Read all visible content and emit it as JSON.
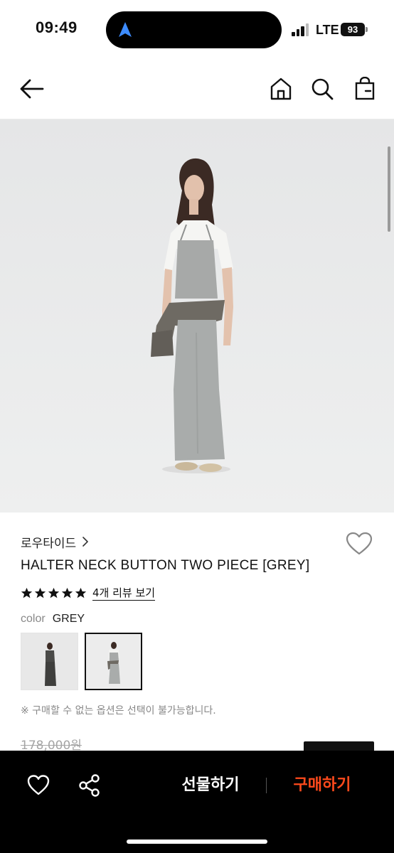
{
  "status_bar": {
    "time": "09:49",
    "network": "LTE",
    "battery": "93"
  },
  "nav": {
    "icons": [
      "back-arrow-icon",
      "home-icon",
      "search-icon",
      "shopping-bag-icon"
    ]
  },
  "product": {
    "brand": "로우타이드",
    "title": "HALTER NECK BUTTON TWO PIECE [GREY]",
    "rating_stars": 5,
    "review_link": "4개 리뷰 보기",
    "color_label": "color",
    "color_value": "GREY",
    "notice": "※ 구매할 수 없는 옵션은 선택이 불가능합니다.",
    "original_price": "178,000원"
  },
  "colors": {
    "background_image": "#e9eaea",
    "buy_accent": "#ff4a1c",
    "bottom_bar": "#000000"
  },
  "bottom_bar": {
    "gift_label": "선물하기",
    "buy_label": "구매하기",
    "icons": [
      "heart-outline-icon",
      "share-icon"
    ]
  }
}
